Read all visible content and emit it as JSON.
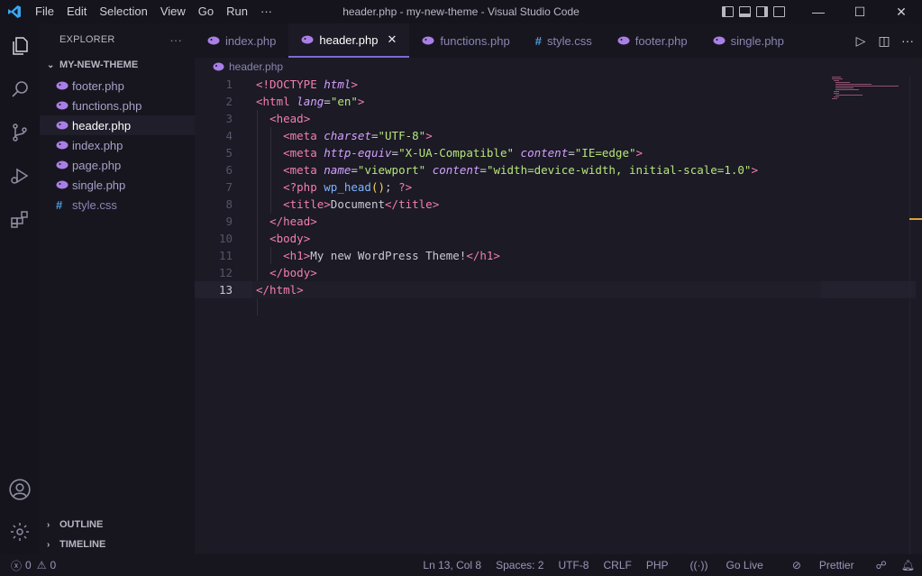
{
  "window": {
    "title": "header.php - my-new-theme - Visual Studio Code",
    "menu": [
      "File",
      "Edit",
      "Selection",
      "View",
      "Go",
      "Run",
      "···"
    ]
  },
  "explorer": {
    "title": "EXPLORER",
    "more": "···",
    "folder": "MY-NEW-THEME",
    "files": [
      {
        "name": "footer.php",
        "type": "php"
      },
      {
        "name": "functions.php",
        "type": "php"
      },
      {
        "name": "header.php",
        "type": "php",
        "active": true
      },
      {
        "name": "index.php",
        "type": "php"
      },
      {
        "name": "page.php",
        "type": "php"
      },
      {
        "name": "single.php",
        "type": "php"
      },
      {
        "name": "style.css",
        "type": "css"
      }
    ],
    "outline": "OUTLINE",
    "timeline": "TIMELINE"
  },
  "tabs": [
    {
      "label": "index.php",
      "icon": "php-icon"
    },
    {
      "label": "header.php",
      "icon": "php-icon",
      "active": true,
      "close": "✕"
    },
    {
      "label": "functions.php",
      "icon": "php-icon"
    },
    {
      "label": "style.css",
      "icon": "css-hash-icon"
    },
    {
      "label": "footer.php",
      "icon": "php-icon"
    },
    {
      "label": "single.php",
      "icon": "php-icon"
    }
  ],
  "breadcrumb": "header.php",
  "code": {
    "line_numbers": [
      "1",
      "2",
      "3",
      "4",
      "5",
      "6",
      "7",
      "8",
      "9",
      "10",
      "11",
      "12",
      "13"
    ],
    "current_line": "13"
  },
  "statusbar": {
    "errors": "0",
    "warnings": "0",
    "position": "Ln 13, Col 8",
    "spaces": "Spaces: 2",
    "encoding": "UTF-8",
    "eol": "CRLF",
    "language": "PHP",
    "golive": "Go Live",
    "prettier": "Prettier"
  },
  "colors": {
    "tag": "#f37fb0",
    "attribute": "#d5a0ff",
    "string": "#b7e57a",
    "php_icon": "#a97fe6",
    "accent": "#7e6ad6"
  }
}
